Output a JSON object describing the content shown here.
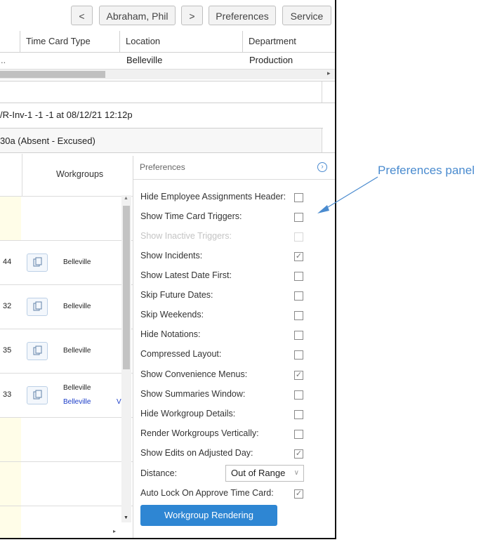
{
  "toolbar": {
    "prev_label": "<",
    "employee_label": "Abraham, Phil",
    "next_label": ">",
    "preferences_label": "Preferences",
    "service_label": "Service"
  },
  "grid": {
    "columns": [
      "Time Card Type",
      "Location",
      "Department"
    ],
    "row": {
      "type": "..",
      "location": "Belleville",
      "department": "Production"
    }
  },
  "info": {
    "trigger_text": "/R-Inv-1 -1 -1 at 08/12/21 12:12p",
    "incident_text": "30a (Absent - Excused)"
  },
  "timecard": {
    "workgroups_header": "Workgroups",
    "rows": [
      {
        "num": "44",
        "workgroup": "Belleville",
        "workgroup2": ""
      },
      {
        "num": "32",
        "workgroup": "Belleville",
        "workgroup2": ""
      },
      {
        "num": "35",
        "workgroup": "Belleville",
        "workgroup2": ""
      },
      {
        "num": "33",
        "workgroup": "Belleville",
        "workgroup2": "Belleville",
        "extra": "V"
      }
    ]
  },
  "preferences": {
    "title": "Preferences",
    "items": [
      {
        "label": "Hide Employee Assignments Header:",
        "checked": false,
        "disabled": false
      },
      {
        "label": "Show Time Card Triggers:",
        "checked": false,
        "disabled": false
      },
      {
        "label": "Show Inactive Triggers:",
        "checked": false,
        "disabled": true
      },
      {
        "label": "Show Incidents:",
        "checked": true,
        "disabled": false
      },
      {
        "label": "Show Latest Date First:",
        "checked": false,
        "disabled": false
      },
      {
        "label": "Skip Future Dates:",
        "checked": false,
        "disabled": false
      },
      {
        "label": "Skip Weekends:",
        "checked": false,
        "disabled": false
      },
      {
        "label": "Hide Notations:",
        "checked": false,
        "disabled": false
      },
      {
        "label": "Compressed Layout:",
        "checked": false,
        "disabled": false
      },
      {
        "label": "Show Convenience Menus:",
        "checked": true,
        "disabled": false
      },
      {
        "label": "Show Summaries Window:",
        "checked": false,
        "disabled": false
      },
      {
        "label": "Hide Workgroup Details:",
        "checked": false,
        "disabled": false
      },
      {
        "label": "Render Workgroups Vertically:",
        "checked": false,
        "disabled": false
      },
      {
        "label": "Show Edits on Adjusted Day:",
        "checked": true,
        "disabled": false
      }
    ],
    "distance_label": "Distance:",
    "distance_value": "Out of Range",
    "autolock_label": "Auto Lock On Approve Time Card:",
    "autolock_checked": true,
    "button_label": "Workgroup Rendering"
  },
  "annotation": {
    "text": "Preferences panel",
    "color": "#4a8bcf"
  },
  "colors": {
    "accent": "#2e86d3",
    "link": "#1a3cc8"
  }
}
